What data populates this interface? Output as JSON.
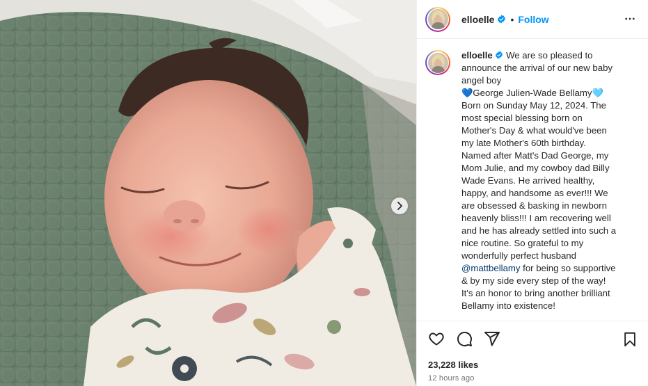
{
  "post": {
    "username": "elloelle",
    "separator": "•",
    "follow_label": "Follow",
    "more_icon": "more-horizontal-icon",
    "verified_icon": "verified-badge-icon",
    "verified_color": "#0095f6"
  },
  "caption": {
    "username": "elloelle",
    "lines": [
      "We are so pleased to",
      "announce the arrival of our new baby",
      "angel boy",
      "💙George Julien-Wade Bellamy🩵",
      "Born on Sunday May 12, 2024. The",
      "most special blessing born on",
      "Mother's Day & what would've been",
      "my late Mother's 60th birthday.",
      "Named after Matt's Dad George, my",
      "Mom Julie, and my cowboy dad Billy",
      "Wade Evans. He arrived healthy,",
      "happy, and handsome as ever!!! We",
      "are obsessed & basking in newborn",
      "heavenly bliss!!! I am recovering well",
      "and he has already settled into such a",
      "nice routine. So grateful to my",
      "wonderfully perfect husband",
      "for being so supportive",
      "& by my side every step of the way!",
      "It's an honor to bring another brilliant",
      "Bellamy into existence!"
    ],
    "mention": "@mattbellamy"
  },
  "actions": {
    "like_icon": "heart-icon",
    "comment_icon": "comment-icon",
    "share_icon": "share-icon",
    "save_icon": "bookmark-icon"
  },
  "stats": {
    "likes": "23,228 likes",
    "time": "12 hours ago"
  },
  "media": {
    "next_icon": "chevron-right-icon"
  },
  "colors": {
    "accent": "#0095f6",
    "mention": "#00376b",
    "secondary_text": "#737373"
  }
}
